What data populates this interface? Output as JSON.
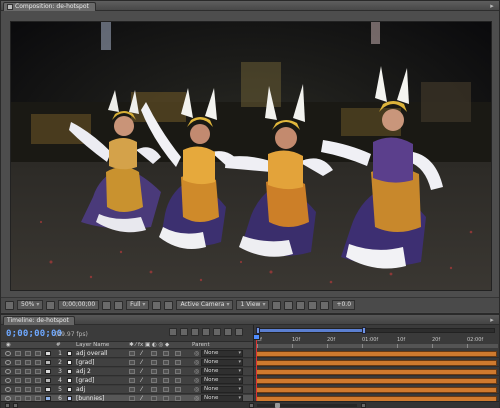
{
  "composition_panel": {
    "tab_label": "Composition: de-hotspot",
    "toolbar": {
      "magnification": "50%",
      "timecode": "0;00;00;00",
      "resolution": "Full",
      "camera": "Active Camera",
      "views": "1 View",
      "offset": "+0.0"
    }
  },
  "timeline_panel": {
    "tab_label": "Timeline: de-hotspot",
    "current_time": "0;00;00;00",
    "fps_label": "(29.97 fps)",
    "columns": {
      "number": "#",
      "layer_name": "Layer Name",
      "parent": "Parent"
    },
    "layers": [
      {
        "num": "1",
        "name": "adj overall",
        "parent": "None",
        "icon_color": "#e6e6e6",
        "label_color": "#d9d9d9",
        "selected": false
      },
      {
        "num": "2",
        "name": "[grad]",
        "parent": "None",
        "icon_color": "#f2f2f2",
        "label_color": "#b7b7b7",
        "selected": false
      },
      {
        "num": "3",
        "name": "adj 2",
        "parent": "None",
        "icon_color": "#e6e6e6",
        "label_color": "#d9d9d9",
        "selected": false
      },
      {
        "num": "4",
        "name": "[grad]",
        "parent": "None",
        "icon_color": "#f2f2f2",
        "label_color": "#b7b7b7",
        "selected": false
      },
      {
        "num": "5",
        "name": "adj",
        "parent": "None",
        "icon_color": "#e6e6e6",
        "label_color": "#d9d9d9",
        "selected": false
      },
      {
        "num": "6",
        "name": "[bunnies]",
        "parent": "None",
        "icon_color": "#c8d8ff",
        "label_color": "#8fb3e8",
        "selected": true
      }
    ],
    "ruler_labels": [
      "0f",
      "10f",
      "20f",
      "01:00f",
      "10f",
      "20f",
      "02:00f"
    ],
    "colors": {
      "accent_blue": "#6ea8ff",
      "layer_bar": "#cf7a2e",
      "playhead": "#dd3333"
    }
  }
}
